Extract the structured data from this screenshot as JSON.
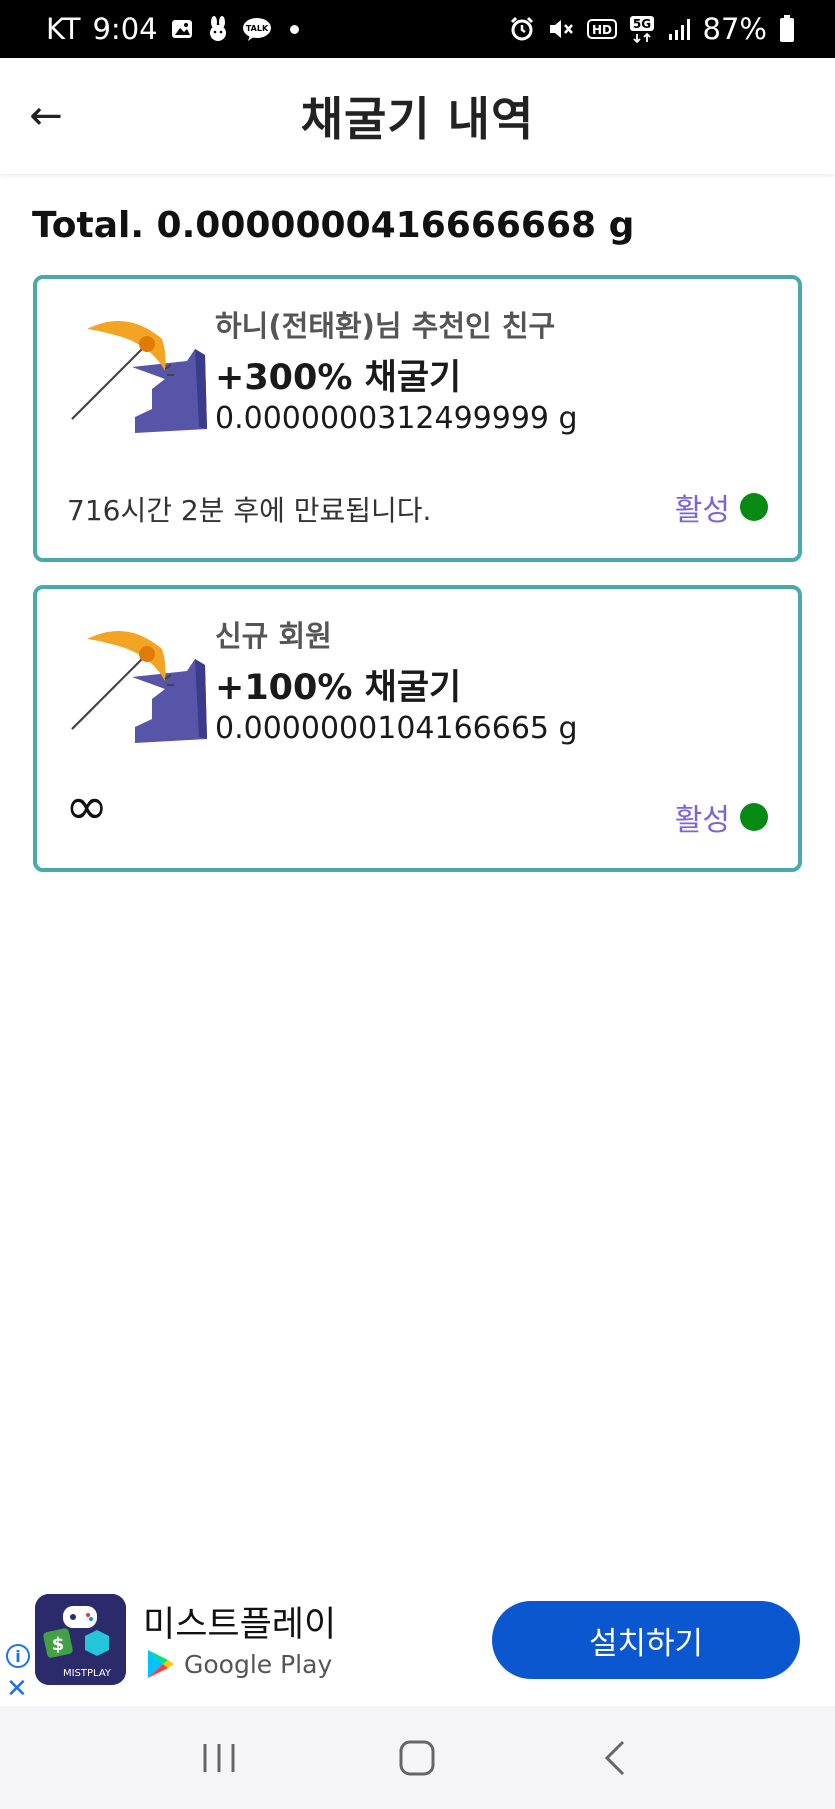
{
  "status_bar": {
    "carrier": "KT",
    "time": "9:04",
    "battery": "87%",
    "left_icons": [
      "gallery-icon",
      "bunny-icon",
      "talk-icon",
      "dot-icon"
    ],
    "right_icons": [
      "alarm-icon",
      "mute-icon",
      "hd-icon",
      "5g-icon",
      "signal-icon",
      "battery-icon"
    ]
  },
  "header": {
    "back_label": "←",
    "title": "채굴기 내역"
  },
  "total": {
    "text": "Total. 0.0000000416666668 g"
  },
  "cards": [
    {
      "subtitle": "하니(전태환)님 추천인 친구",
      "boost": "+300% 채굴기",
      "amount": "0.0000000312499999 g",
      "expire": "716시간 2분 후에 만료됩니다.",
      "status": "활성",
      "status_color": "#078a14"
    },
    {
      "subtitle": "신규 회원",
      "boost": "+100% 채굴기",
      "amount": "0.0000000104166665 g",
      "expire": "∞",
      "status": "활성",
      "status_color": "#078a14"
    }
  ],
  "ad": {
    "app_name": "미스트플레이",
    "store": "Google Play",
    "icon_brand": "MISTPLAY",
    "install_label": "설치하기",
    "info_label": "i",
    "close_label": "✕",
    "button_color": "#0b57d0"
  },
  "nav": {
    "recents_label": "|||",
    "home_label": "▢",
    "back_label": "‹"
  },
  "colors": {
    "card_border": "#4aa9ad",
    "status_text": "#7b63d8"
  }
}
